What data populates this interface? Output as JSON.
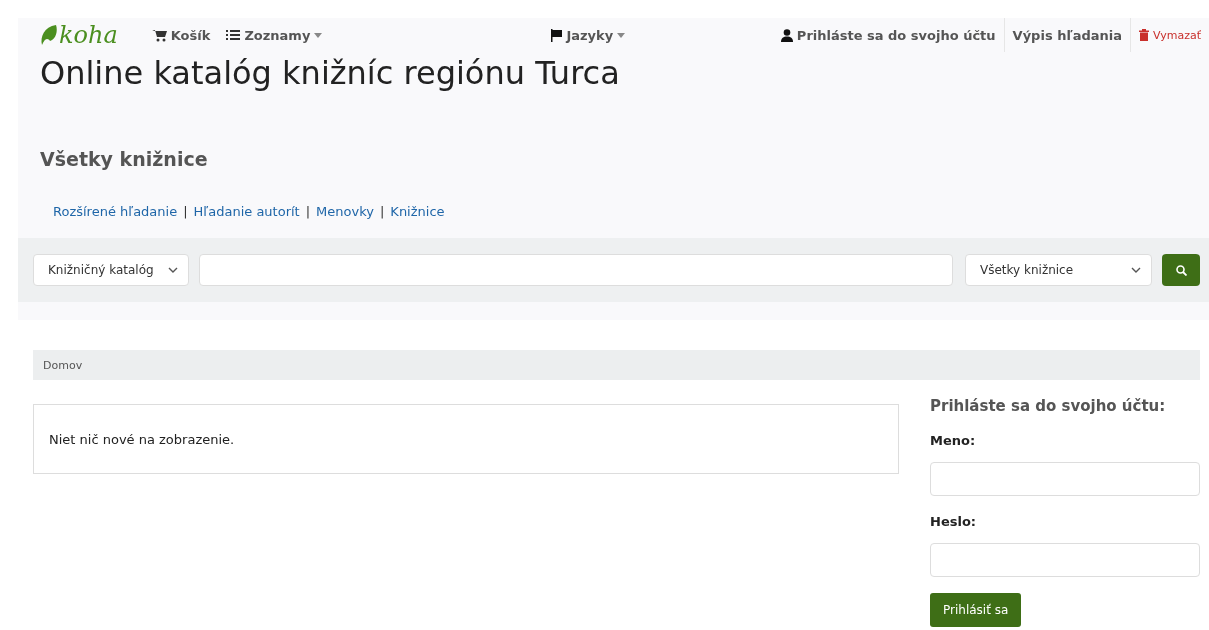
{
  "navbar": {
    "logo": "koha",
    "left_items": [
      {
        "label": "Košík",
        "dropdown": false
      },
      {
        "label": "Zoznamy",
        "dropdown": true
      }
    ],
    "center_items": [
      {
        "label": "Jazyky",
        "dropdown": true
      }
    ],
    "right_items": [
      {
        "label": "Prihláste sa do svojho účtu",
        "kind": "link"
      },
      {
        "label": "Výpis hľadania",
        "kind": "link"
      },
      {
        "label": "Vymazať",
        "kind": "danger"
      }
    ]
  },
  "title": "Online katalóg knižníc regiónu Turca",
  "library_heading": "Všetky knižnice",
  "links": [
    "Rozšírené hľadanie",
    "Hľadanie autorít",
    "Menovky",
    "Knižnice"
  ],
  "link_separator": "|",
  "search": {
    "catalog_select": "Knižničný katalóg",
    "library_select": "Všetky knižnice"
  },
  "breadcrumb": [
    "Domov"
  ],
  "news": "Niet nič nové na zobrazenie.",
  "login": {
    "heading": "Prihláste sa do svojho účtu:",
    "fields": [
      {
        "label": "Meno:"
      },
      {
        "label": "Heslo:"
      }
    ],
    "button": "Prihlásiť sa"
  }
}
